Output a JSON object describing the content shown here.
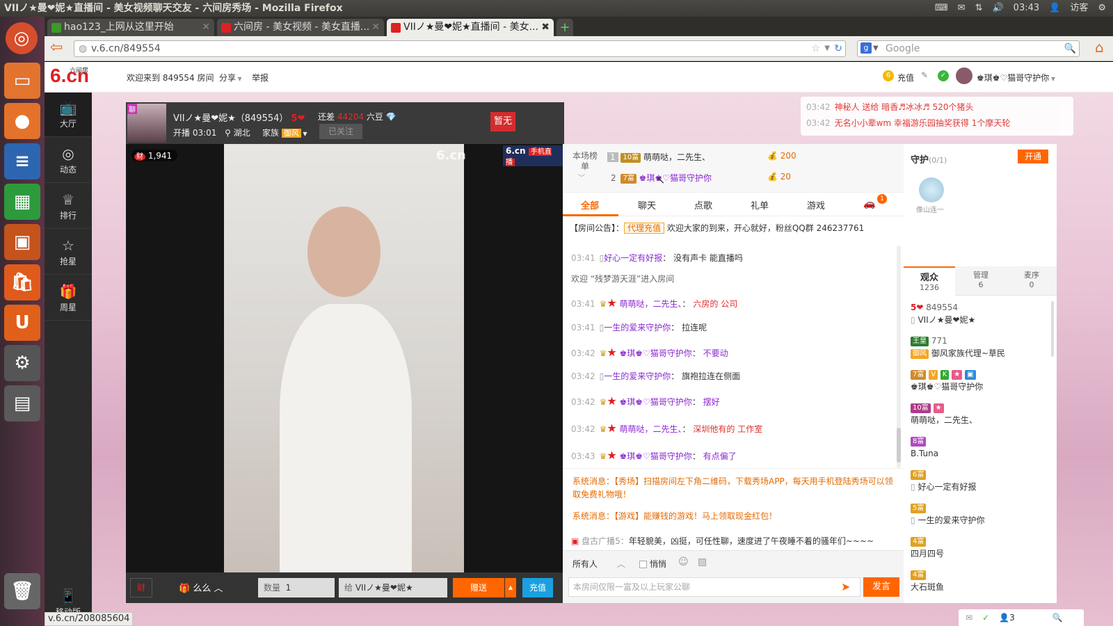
{
  "window_title": "VIIノ★曼❤妮★直播间 - 美女视频聊天交友 - 六间房秀场 - Mozilla Firefox",
  "system": {
    "time": "03:43",
    "user": "访客"
  },
  "tabs": [
    {
      "label": "hao123_上网从这里开始"
    },
    {
      "label": "六间房 - 美女视频 - 美女直播..."
    },
    {
      "label": "VIIノ★曼❤妮★直播间 - 美女..."
    }
  ],
  "url": "v.6.cn/849554",
  "search_placeholder": "Google",
  "status_url": "v.6.cn/208085604",
  "header": {
    "logo": "6.cn",
    "logo_sub": "六间房",
    "welcome": "欢迎来到 849554 房间",
    "share": "分享",
    "report": "举报",
    "recharge": "充值",
    "username": "♚琪♚♡猫哥守护你"
  },
  "sidebar": [
    {
      "label": "大厅"
    },
    {
      "label": "动态"
    },
    {
      "label": "排行"
    },
    {
      "label": "抢星"
    },
    {
      "label": "周星"
    }
  ],
  "sidebar_mobile": "移动版",
  "ticker": [
    {
      "time": "03:42",
      "text": "神秘人 送给 暗香♬冰冰♬ 520个猪头"
    },
    {
      "time": "03:42",
      "text": "无名小小辈wm 幸福游乐园抽奖获得 1个摩天轮"
    }
  ],
  "host": {
    "name": "VIIノ★曼❤妮★（849554）",
    "level": "5",
    "remaining": "还差",
    "beans": "44204",
    "unit": "六豆",
    "start": "开播 03:01",
    "location": "湖北",
    "family_label": "家族",
    "family": "御风",
    "followed": "已关注",
    "flag": "暂无",
    "chat_tag": "聊"
  },
  "video": {
    "wealth": "1,941",
    "watermark": "6.cn",
    "mobile_tag": "手机直播"
  },
  "bottom": {
    "gift": "么么",
    "qty_label": "数量",
    "qty": "1",
    "to_label": "给",
    "to": "VIIノ★曼❤妮★",
    "send": "赠送",
    "recharge": "充值",
    "cai": "财"
  },
  "rank": {
    "title": "本场榜单",
    "rows": [
      {
        "n": "1",
        "badge": "10富",
        "name": "萌萌哒，二先生、",
        "val": "200"
      },
      {
        "n": "2",
        "badge": "7富",
        "name": "♚琪♚♡猫哥守护你",
        "val": "20"
      }
    ]
  },
  "chat_tabs": [
    {
      "label": "全部"
    },
    {
      "label": "聊天"
    },
    {
      "label": "点歌"
    },
    {
      "label": "礼单"
    },
    {
      "label": "游戏"
    }
  ],
  "car_badge": "1",
  "notice": {
    "label": "【房间公告】：",
    "tag": "代理充值",
    "text": "欢迎大家的到来，开心就好，粉丝QQ群 246237761"
  },
  "messages": [
    {
      "time": "03:41",
      "user": "好心一定有好报",
      "sep": "：",
      "text": "没有声卡 能直播吗"
    },
    {
      "time": "",
      "user": "",
      "sep": "",
      "text": "欢迎 “残梦游天涯”进入房间"
    },
    {
      "time": "03:41",
      "user": "萌萌哒，二先生、",
      "sep": "：",
      "text": "六房的 公司"
    },
    {
      "time": "03:41",
      "user": "一生的爱来守护你",
      "sep": "：",
      "text": "拉连呢"
    },
    {
      "time": "03:42",
      "user": "♚琪♚♡猫哥守护你",
      "sep": "：",
      "text": "不要动"
    },
    {
      "time": "03:42",
      "user": "一生的爱来守护你",
      "sep": "：",
      "text": "旗袍拉连在侧面"
    },
    {
      "time": "03:42",
      "user": "♚琪♚♡猫哥守护你",
      "sep": "：",
      "text": "摆好"
    },
    {
      "time": "03:42",
      "user": "萌萌哒，二先生、",
      "sep": "：",
      "text": "深圳他有的 工作室"
    },
    {
      "time": "03:43",
      "user": "♚琪♚♡猫哥守护你",
      "sep": "：",
      "text": "有点偏了"
    }
  ],
  "system_msgs": [
    "系统消息：【秀场】扫描房间左下角二维码，下载秀场APP，每天用手机登陆秀场可以领",
    "取免费礼物哦！",
    "系统消息：【游戏】能赚钱的游戏！马上领取现金红包！"
  ],
  "broadcast": {
    "label": "盘古广播5：",
    "text": "年轻貌美，凶挺，可任性聊，速度进了午夜睡不着的骚年们~~~~"
  },
  "chat_input": {
    "target": "所有人",
    "private": "悄悄",
    "placeholder": "本房间仅限一富及以上玩家公聊",
    "send": "发言"
  },
  "guard": {
    "title": "守护",
    "count": "(0/1)",
    "open": "开通",
    "placeholder": "像山连一"
  },
  "audience_tabs": [
    {
      "label": "观众",
      "count": "1236"
    },
    {
      "label": "管理",
      "count": "6"
    },
    {
      "label": "麦序",
      "count": "0"
    }
  ],
  "audience": [
    {
      "badge": "5",
      "line1": "849554",
      "line2": "VIIノ★曼❤妮★"
    },
    {
      "badge": "王皇",
      "line1": "771",
      "line2": "御风家族代理~草民"
    },
    {
      "badge": "7富",
      "line1": "",
      "line2": "♚琪♚♡猫哥守护你"
    },
    {
      "badge": "10富",
      "line1": "",
      "line2": "萌萌哒，二先生、"
    },
    {
      "badge": "8富",
      "line1": "",
      "line2": "B.Tuna"
    },
    {
      "badge": "6富",
      "line1": "",
      "line2": "好心一定有好报"
    },
    {
      "badge": "5富",
      "line1": "",
      "line2": "一生的爱来守护你"
    },
    {
      "badge": "4富",
      "line1": "",
      "line2": "四月四号"
    },
    {
      "badge": "4富",
      "line1": "",
      "line2": "大石斑鱼"
    }
  ],
  "footer_count": "3"
}
